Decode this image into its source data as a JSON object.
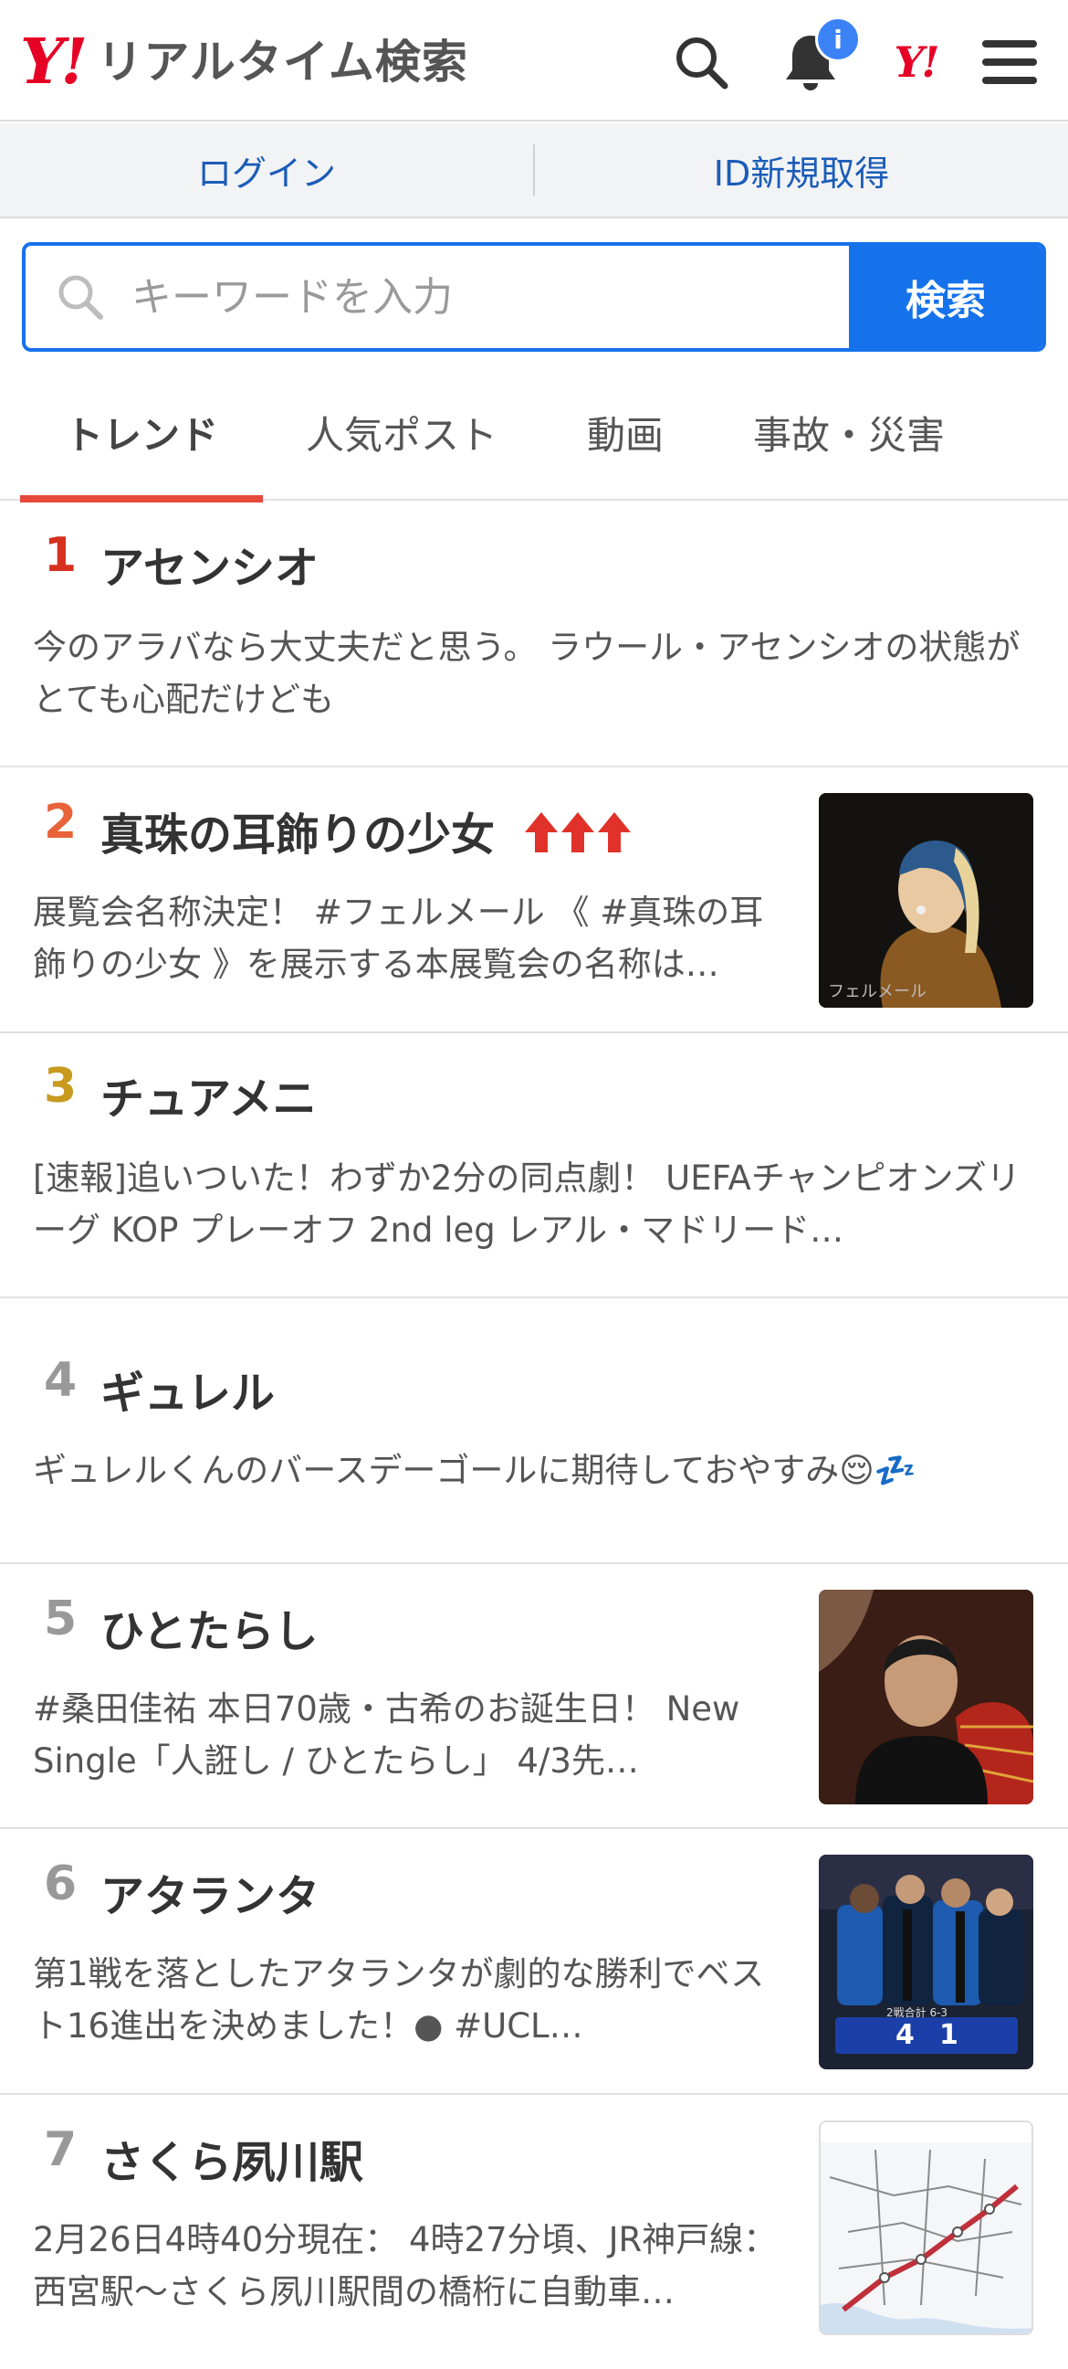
{
  "header": {
    "logo_mark": "Y!",
    "logo_text": "リアルタイム検索",
    "notification_badge": "i",
    "yahoo_mark": "Y!"
  },
  "login_bar": {
    "login": "ログイン",
    "signup": "ID新規取得"
  },
  "search": {
    "placeholder": "キーワードを入力",
    "button": "検索"
  },
  "tabs": [
    {
      "label": "トレンド",
      "active": true
    },
    {
      "label": "人気ポスト",
      "active": false
    },
    {
      "label": "動画",
      "active": false
    },
    {
      "label": "事故・災害",
      "active": false
    }
  ],
  "colors": {
    "brand_red": "#e60026",
    "accent_blue": "#1672eb",
    "rank1": "#d6301f",
    "rank2": "#e8623a",
    "rank3": "#c89a1e",
    "rank_other": "#999999"
  },
  "trends": [
    {
      "rank": "1",
      "title": "アセンシオ",
      "desc": "今のアラバなら大丈夫だと思う。 ラウール・アセンシオの状態がとても心配だけども",
      "thumb": null
    },
    {
      "rank": "2",
      "title": "真珠の耳飾りの少女",
      "desc": "展覧会名称決定！ #フェルメール 《 #真珠の耳飾りの少女 》を展示する本展覧会の名称は…",
      "thumb": "painting-girl-pearl",
      "rising": true,
      "thumb_caption": "フェルメール"
    },
    {
      "rank": "3",
      "title": "チュアメニ",
      "desc": "[速報]追いついた！わずか2分の同点劇！ UEFAチャンピオンズリーグ KOP プレーオフ 2nd leg レアル・マドリード…",
      "thumb": null
    },
    {
      "rank": "4",
      "title": "ギュレル",
      "desc": "ギュレルくんのバースデーゴールに期待しておやすみ😌💤",
      "thumb": null
    },
    {
      "rank": "5",
      "title": "ひとたらし",
      "desc": "#桑田佳祐 本日70歳・古希のお誕生日！ New Single「人誑し / ひとたらし」 4/3先…",
      "thumb": "portrait-man-fan"
    },
    {
      "rank": "6",
      "title": "アタランタ",
      "desc": "第1戦を落としたアタランタが劇的な勝利でベスト16進出を決めました！● #UCL…",
      "thumb": "soccer-celebration",
      "thumb_score": [
        "4",
        "1"
      ],
      "thumb_agg": "2戦合計 6-3"
    },
    {
      "rank": "7",
      "title": "さくら夙川駅",
      "desc": "2月26日4時40分現在： 4時27分頃、JR神戸線：西宮駅〜さくら夙川駅間の橋桁に自動車…",
      "thumb": "railway-map"
    }
  ]
}
